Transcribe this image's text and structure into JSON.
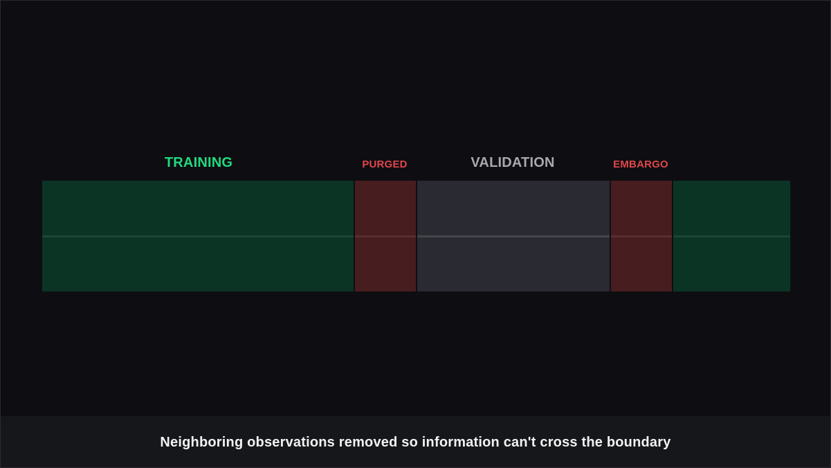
{
  "labels": {
    "training": "TRAINING",
    "purged": "PURGED",
    "validation": "VALIDATION",
    "embargo": "EMBARGO"
  },
  "caption": "Neighboring observations removed so information can't cross the boundary",
  "colors": {
    "background": "#0e0e12",
    "training_fill": "#0b3424",
    "training_label": "#22d97f",
    "purged_fill": "#481d20",
    "purged_label": "#e0464a",
    "validation_fill": "#2a2a32",
    "validation_label": "#a8a8ad",
    "embargo_fill": "#481d20",
    "embargo_label": "#e0464a",
    "caption_bar": "#16171b",
    "caption_text": "#f2f2f2"
  }
}
